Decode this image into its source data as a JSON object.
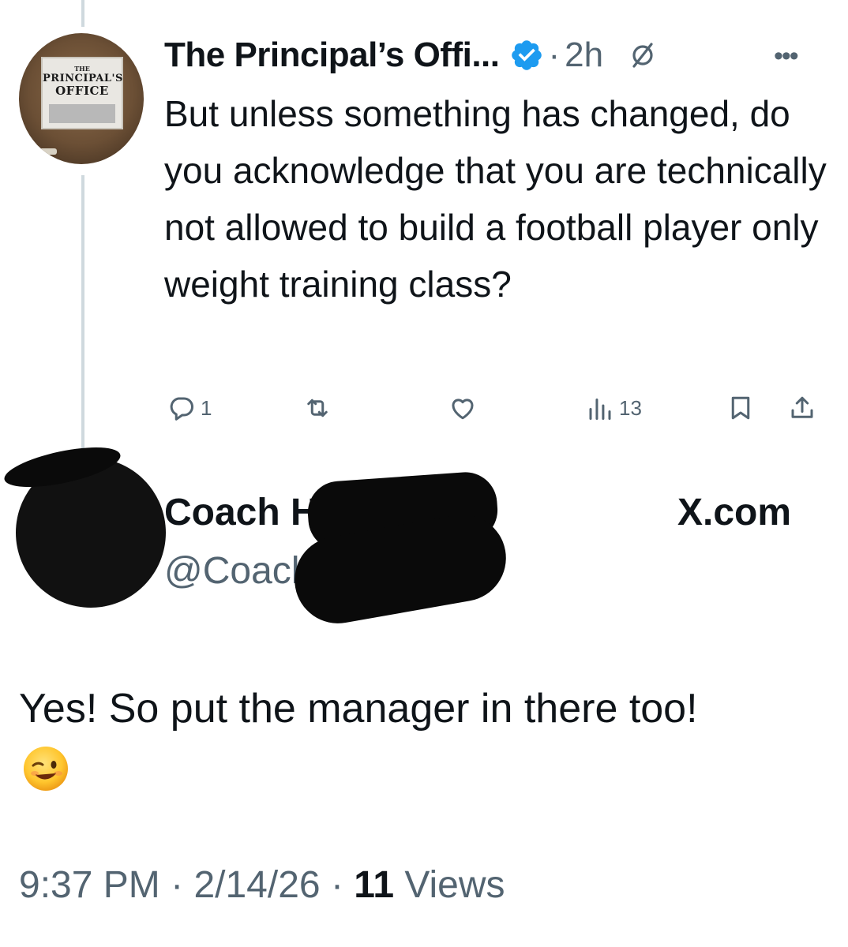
{
  "parent_tweet": {
    "avatar_alt": "THE PRINCIPAL'S OFFICE",
    "avatar_sign": {
      "line1": "THE",
      "line2": "PRINCIPAL'S",
      "line3": "OFFICE"
    },
    "display_name": "The Principal’s Offi...",
    "verified_icon": "verified-badge-icon",
    "separator": "·",
    "time": "2h",
    "text": "But unless something has changed, do you acknowledge that you are technically not allowed to build a football player only weight training class?",
    "actions": {
      "reply_count": "1",
      "repost_count": "",
      "like_count": "",
      "views_count": "13"
    }
  },
  "quoted": {
    "name": "Coach Hendrix",
    "handle": "@Coach",
    "source": "X.com"
  },
  "reply": {
    "text": "Yes! So put the manager in there too!",
    "emoji": "winking-face"
  },
  "footer": {
    "time": "9:37 PM",
    "sep1": "·",
    "date": "2/14/26",
    "sep2": "·",
    "views_count": "11",
    "views_label": "Views"
  },
  "colors": {
    "text": "#0f1419",
    "secondary": "#536471",
    "verified": "#1d9bf0",
    "thread_line": "#cfd9de"
  }
}
